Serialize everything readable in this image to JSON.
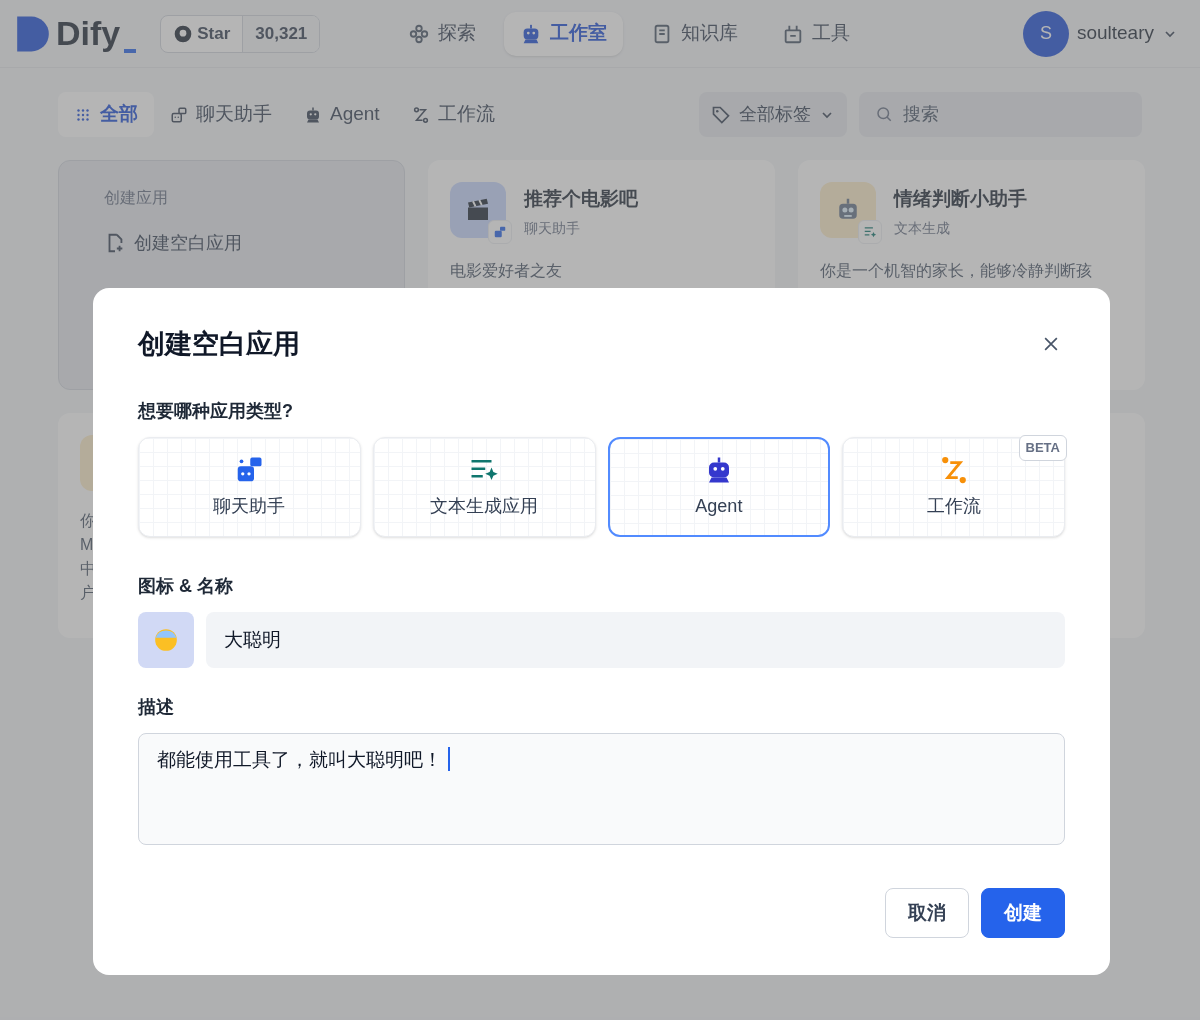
{
  "header": {
    "logo": "Dify",
    "github": {
      "label": "Star",
      "count": "30,321"
    },
    "nav": [
      {
        "label": "探索",
        "kind": "explore",
        "selected": false
      },
      {
        "label": "工作室",
        "kind": "robot",
        "selected": true
      },
      {
        "label": "知识库",
        "kind": "book",
        "selected": false
      },
      {
        "label": "工具",
        "kind": "tools",
        "selected": false
      }
    ],
    "user": {
      "initial": "S",
      "name": "soulteary"
    }
  },
  "filters": [
    {
      "label": "全部",
      "kind": "grid",
      "selected": true
    },
    {
      "label": "聊天助手",
      "kind": "chat",
      "selected": false
    },
    {
      "label": "Agent",
      "kind": "robot",
      "selected": false
    },
    {
      "label": "工作流",
      "kind": "flow",
      "selected": false
    }
  ],
  "tag_filter": "全部标签",
  "search": {
    "placeholder": "搜索"
  },
  "create_card": {
    "title": "创建应用",
    "items": [
      "创建空白应用"
    ]
  },
  "apps": [
    {
      "name": "推荐个电影吧",
      "type": "聊天助手",
      "description": "电影爱好者之友",
      "kind": "chat"
    },
    {
      "name": "情绪判断小助手",
      "type": "文本生成",
      "description": "你是一个机智的家长，能够冷静判断孩",
      "kind": "text"
    }
  ],
  "hidden_card_fragments": [
    "你",
    "M",
    "中",
    "户"
  ],
  "modal": {
    "title": "创建空白应用",
    "type_label": "想要哪种应用类型?",
    "types": [
      {
        "label": "聊天助手",
        "kind": "chat",
        "selected": false
      },
      {
        "label": "文本生成应用",
        "kind": "text",
        "selected": false
      },
      {
        "label": "Agent",
        "kind": "agent",
        "selected": true
      },
      {
        "label": "工作流",
        "kind": "workflow",
        "selected": false,
        "badge": "BETA"
      }
    ],
    "name_label": "图标 & 名称",
    "name_value": "大聪明",
    "description_label": "描述",
    "description_value": "都能使用工具了，就叫大聪明吧！",
    "description_focused": true,
    "buttons": [
      {
        "label": "取消",
        "kind": "secondary"
      },
      {
        "label": "创建",
        "kind": "primary"
      }
    ]
  }
}
